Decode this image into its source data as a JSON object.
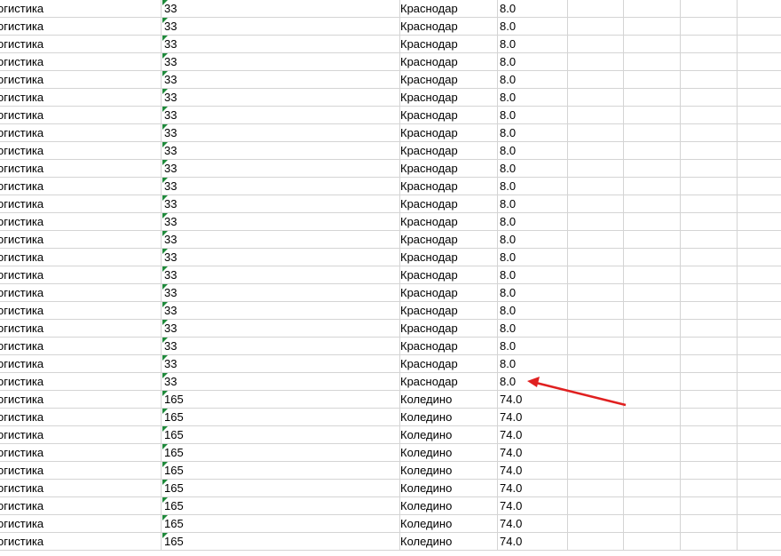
{
  "sheet": {
    "rows": [
      {
        "category": "огистика",
        "code": "33",
        "city": "Краснодар",
        "value": "8.0"
      },
      {
        "category": "огистика",
        "code": "33",
        "city": "Краснодар",
        "value": "8.0"
      },
      {
        "category": "огистика",
        "code": "33",
        "city": "Краснодар",
        "value": "8.0"
      },
      {
        "category": "огистика",
        "code": "33",
        "city": "Краснодар",
        "value": "8.0"
      },
      {
        "category": "огистика",
        "code": "33",
        "city": "Краснодар",
        "value": "8.0"
      },
      {
        "category": "огистика",
        "code": "33",
        "city": "Краснодар",
        "value": "8.0"
      },
      {
        "category": "огистика",
        "code": "33",
        "city": "Краснодар",
        "value": "8.0"
      },
      {
        "category": "огистика",
        "code": "33",
        "city": "Краснодар",
        "value": "8.0"
      },
      {
        "category": "огистика",
        "code": "33",
        "city": "Краснодар",
        "value": "8.0"
      },
      {
        "category": "огистика",
        "code": "33",
        "city": "Краснодар",
        "value": "8.0"
      },
      {
        "category": "огистика",
        "code": "33",
        "city": "Краснодар",
        "value": "8.0"
      },
      {
        "category": "огистика",
        "code": "33",
        "city": "Краснодар",
        "value": "8.0"
      },
      {
        "category": "огистика",
        "code": "33",
        "city": "Краснодар",
        "value": "8.0"
      },
      {
        "category": "огистика",
        "code": "33",
        "city": "Краснодар",
        "value": "8.0"
      },
      {
        "category": "огистика",
        "code": "33",
        "city": "Краснодар",
        "value": "8.0"
      },
      {
        "category": "огистика",
        "code": "33",
        "city": "Краснодар",
        "value": "8.0"
      },
      {
        "category": "огистика",
        "code": "33",
        "city": "Краснодар",
        "value": "8.0"
      },
      {
        "category": "огистика",
        "code": "33",
        "city": "Краснодар",
        "value": "8.0"
      },
      {
        "category": "огистика",
        "code": "33",
        "city": "Краснодар",
        "value": "8.0"
      },
      {
        "category": "огистика",
        "code": "33",
        "city": "Краснодар",
        "value": "8.0"
      },
      {
        "category": "огистика",
        "code": "33",
        "city": "Краснодар",
        "value": "8.0"
      },
      {
        "category": "огистика",
        "code": "33",
        "city": "Краснодар",
        "value": "8.0"
      },
      {
        "category": "огистика",
        "code": "165",
        "city": "Коледино",
        "value": "74.0"
      },
      {
        "category": "огистика",
        "code": "165",
        "city": "Коледино",
        "value": "74.0"
      },
      {
        "category": "огистика",
        "code": "165",
        "city": "Коледино",
        "value": "74.0"
      },
      {
        "category": "огистика",
        "code": "165",
        "city": "Коледино",
        "value": "74.0"
      },
      {
        "category": "огистика",
        "code": "165",
        "city": "Коледино",
        "value": "74.0"
      },
      {
        "category": "огистика",
        "code": "165",
        "city": "Коледино",
        "value": "74.0"
      },
      {
        "category": "огистика",
        "code": "165",
        "city": "Коледино",
        "value": "74.0"
      },
      {
        "category": "огистика",
        "code": "165",
        "city": "Коледино",
        "value": "74.0"
      },
      {
        "category": "огистика",
        "code": "165",
        "city": "Коледино",
        "value": "74.0"
      }
    ]
  },
  "colors": {
    "gridline": "#d4d4d4",
    "error_indicator": "#1f8a3b",
    "annotation_arrow": "#e02020"
  },
  "icons": {
    "error_indicator": "green-triangle-icon",
    "annotation": "red-arrow-icon"
  }
}
